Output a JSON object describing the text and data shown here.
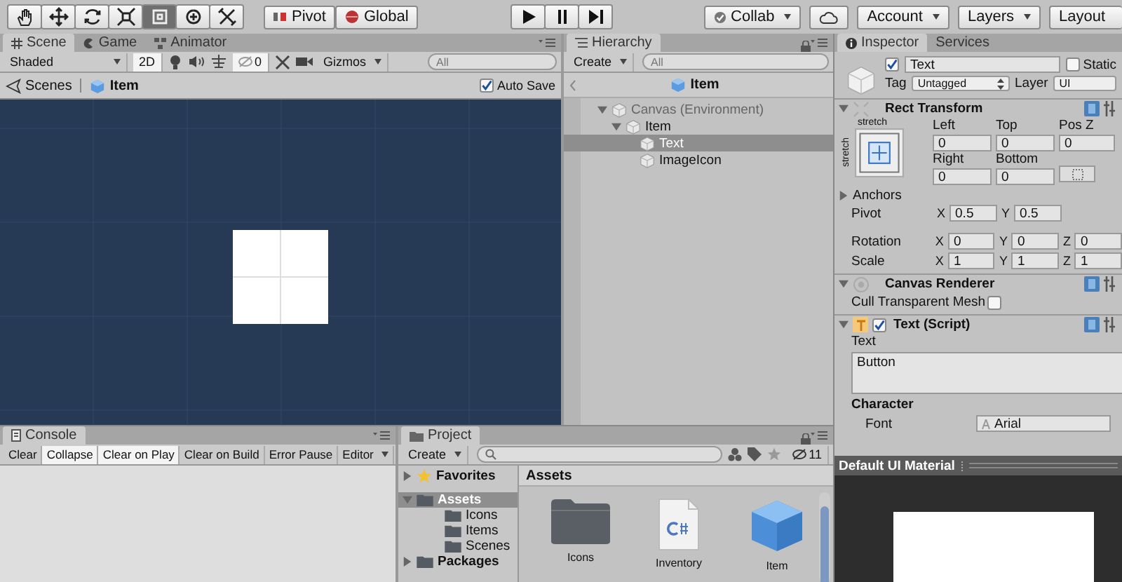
{
  "toolbar": {
    "tools": [
      {
        "kind": "hand",
        "selected": false
      },
      {
        "kind": "move",
        "selected": false
      },
      {
        "kind": "rotate",
        "selected": false
      },
      {
        "kind": "scale",
        "selected": false
      },
      {
        "kind": "rect",
        "selected": true
      },
      {
        "kind": "transform",
        "selected": false
      },
      {
        "kind": "custom",
        "selected": false
      }
    ],
    "pivot": "Pivot",
    "space": "Global",
    "collab": "Collab",
    "account": "Account",
    "layers": "Layers",
    "layout": "Layout"
  },
  "scene": {
    "tabs": [
      {
        "label": "Scene",
        "kind": "scene",
        "selected": true
      },
      {
        "label": "Game",
        "kind": "game",
        "selected": false
      },
      {
        "label": "Animator",
        "kind": "animator",
        "selected": false
      }
    ],
    "shading": "Shaded",
    "mode_2d": {
      "label": "2D",
      "on": true
    },
    "hidden_count": "0",
    "gizmos": "Gizmos",
    "search": {
      "placeholder": "All"
    },
    "breadcrumb": [
      "Scenes",
      "Item"
    ],
    "auto_save": {
      "label": "Auto Save",
      "checked": true
    }
  },
  "hierarchy": {
    "tab": "Hierarchy",
    "create": "Create",
    "search": {
      "placeholder": "All"
    },
    "header": "Item",
    "tree": [
      {
        "label": "Canvas (Environment)",
        "dimmed": true,
        "expanded": true,
        "selected": false,
        "children": [
          {
            "label": "Item",
            "dimmed": false,
            "expanded": true,
            "selected": false,
            "children": [
              {
                "label": "Text",
                "dimmed": false,
                "selected": true
              },
              {
                "label": "ImageIcon",
                "dimmed": false,
                "selected": false
              }
            ]
          }
        ]
      }
    ]
  },
  "inspector": {
    "tabs": [
      {
        "label": "Inspector",
        "selected": true
      },
      {
        "label": "Services",
        "selected": false
      }
    ],
    "object": {
      "active": true,
      "name": "Text",
      "static": {
        "label": "Static",
        "checked": false
      },
      "tag": {
        "label": "Tag",
        "value": "Untagged"
      },
      "layer": {
        "label": "Layer",
        "value": "UI"
      }
    },
    "rect_transform": {
      "title": "Rect Transform",
      "expanded": true,
      "anchor_labels": {
        "horizontal": "stretch",
        "vertical": "stretch"
      },
      "fields": [
        {
          "label": "Left",
          "value": "0"
        },
        {
          "label": "Top",
          "value": "0"
        },
        {
          "label": "Pos Z",
          "value": "0"
        },
        {
          "label": "Right",
          "value": "0"
        },
        {
          "label": "Bottom",
          "value": "0"
        }
      ],
      "anchors": {
        "label": "Anchors",
        "expanded": false
      },
      "vectors": [
        {
          "label": "Pivot",
          "components": [
            {
              "axis": "X",
              "value": "0.5"
            },
            {
              "axis": "Y",
              "value": "0.5"
            }
          ]
        },
        {
          "label": "Rotation",
          "components": [
            {
              "axis": "X",
              "value": "0"
            },
            {
              "axis": "Y",
              "value": "0"
            },
            {
              "axis": "Z",
              "value": "0"
            }
          ]
        },
        {
          "label": "Scale",
          "components": [
            {
              "axis": "X",
              "value": "1"
            },
            {
              "axis": "Y",
              "value": "1"
            },
            {
              "axis": "Z",
              "value": "1"
            }
          ]
        }
      ]
    },
    "canvas_renderer": {
      "title": "Canvas Renderer",
      "expanded": true,
      "cull": {
        "label": "Cull Transparent Mesh",
        "checked": false
      }
    },
    "text_script": {
      "title": "Text (Script)",
      "expanded": true,
      "enabled": true,
      "text_label": "Text",
      "text_value": "Button",
      "section": "Character",
      "font": {
        "label": "Font",
        "value": "Arial"
      }
    },
    "preview": {
      "title": "Default UI Material"
    }
  },
  "console": {
    "tab": "Console",
    "buttons": [
      {
        "label": "Clear",
        "on": false
      },
      {
        "label": "Collapse",
        "on": true
      },
      {
        "label": "Clear on Play",
        "on": true
      },
      {
        "label": "Clear on Build",
        "on": false
      },
      {
        "label": "Error Pause",
        "on": false
      }
    ],
    "editor": "Editor"
  },
  "project": {
    "tab": "Project",
    "create": "Create",
    "hidden_count": "11",
    "tree": [
      {
        "label": "Favorites",
        "kind": "favorites",
        "expanded": false,
        "selected": false
      },
      {
        "label": "Assets",
        "kind": "folder",
        "expanded": true,
        "selected": true,
        "children": [
          {
            "label": "Icons",
            "kind": "folder",
            "selected": false
          },
          {
            "label": "Items",
            "kind": "folder",
            "selected": false
          },
          {
            "label": "Scenes",
            "kind": "folder",
            "selected": false
          }
        ]
      },
      {
        "label": "Packages",
        "kind": "folder",
        "expanded": false,
        "selected": false
      }
    ],
    "path": "Assets",
    "assets": [
      {
        "name": "Icons",
        "kind": "folder"
      },
      {
        "name": "Inventory",
        "kind": "script"
      },
      {
        "name": "Item",
        "kind": "prefab"
      }
    ]
  }
}
